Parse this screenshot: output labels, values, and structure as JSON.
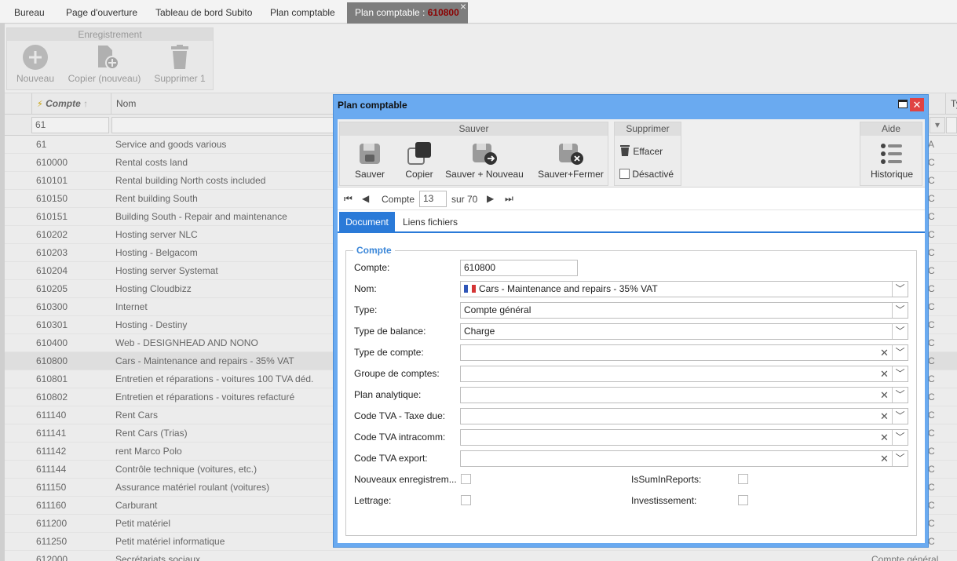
{
  "tabs": [
    {
      "label": "Bureau"
    },
    {
      "label": "Page d'ouverture"
    },
    {
      "label": "Tableau de bord Subito"
    },
    {
      "label": "Plan comptable"
    },
    {
      "label": "Plan comptable : ",
      "code": "610800",
      "close": "×"
    }
  ],
  "ribbon": {
    "group_title": "Enregistrement",
    "nouveau": "Nouveau",
    "copier": "Copier (nouveau)",
    "supprimer": "Supprimer 1"
  },
  "grid": {
    "col_compte": "Compte",
    "col_nom": "Nom",
    "col_type_partial": "Ty",
    "filter_compte": "61",
    "rows": [
      {
        "compte": "61",
        "nom": "Service and goods various",
        "right": "A"
      },
      {
        "compte": "610000",
        "nom": "Rental costs land",
        "right": "C"
      },
      {
        "compte": "610101",
        "nom": "Rental building North costs included",
        "right": "C"
      },
      {
        "compte": "610150",
        "nom": "Rent building South",
        "right": "C"
      },
      {
        "compte": "610151",
        "nom": "Building South - Repair and maintenance",
        "right": "C"
      },
      {
        "compte": "610202",
        "nom": "Hosting server NLC",
        "right": "C"
      },
      {
        "compte": "610203",
        "nom": "Hosting - Belgacom",
        "right": "C"
      },
      {
        "compte": "610204",
        "nom": "Hosting server Systemat",
        "right": "C"
      },
      {
        "compte": "610205",
        "nom": "Hosting Cloudbizz",
        "right": "C"
      },
      {
        "compte": "610300",
        "nom": "Internet",
        "right": "C"
      },
      {
        "compte": "610301",
        "nom": "Hosting - Destiny",
        "right": "C"
      },
      {
        "compte": "610400",
        "nom": "Web - DESIGNHEAD AND NONO",
        "right": "C"
      },
      {
        "compte": "610800",
        "nom": "Cars - Maintenance and repairs - 35% VAT",
        "right": "C"
      },
      {
        "compte": "610801",
        "nom": "Entretien et réparations - voitures 100 TVA déd.",
        "right": "C"
      },
      {
        "compte": "610802",
        "nom": "Entretien et réparations - voitures refacturé",
        "right": "C"
      },
      {
        "compte": "611140",
        "nom": "Rent Cars",
        "right": "C"
      },
      {
        "compte": "611141",
        "nom": "Rent Cars (Trias)",
        "right": "C"
      },
      {
        "compte": "611142",
        "nom": "rent Marco Polo",
        "right": "C"
      },
      {
        "compte": "611144",
        "nom": "Contrôle technique (voitures, etc.)",
        "right": "C"
      },
      {
        "compte": "611150",
        "nom": "Assurance matériel roulant (voitures)",
        "right": "C"
      },
      {
        "compte": "611160",
        "nom": "Carburant",
        "right": "C"
      },
      {
        "compte": "611200",
        "nom": "Petit matériel",
        "right": "C"
      },
      {
        "compte": "611250",
        "nom": "Petit matériel informatique",
        "right": "C"
      },
      {
        "compte": "612000",
        "nom": "Secrétariats sociaux",
        "right": "Compte général"
      }
    ]
  },
  "dialog": {
    "title": "Plan comptable",
    "sauver_group": "Sauver",
    "sauver": "Sauver",
    "copier": "Copier",
    "sauver_nouveau": "Sauver + Nouveau",
    "sauver_fermer": "Sauver+Fermer",
    "supprimer_group": "Supprimer",
    "effacer": "Effacer",
    "desactive": "Désactivé",
    "aide_group": "Aide",
    "historique": "Historique",
    "nav_label": "Compte",
    "nav_value": "13",
    "nav_total": "sur 70",
    "tab_document": "Document",
    "tab_liens": "Liens fichiers",
    "section": "Compte",
    "fields": {
      "compte_label": "Compte:",
      "compte_value": "610800",
      "nom_label": "Nom:",
      "nom_value": "Cars - Maintenance and repairs - 35% VAT",
      "type_label": "Type:",
      "type_value": "Compte général",
      "balance_label": "Type de balance:",
      "balance_value": "Charge",
      "typecompte_label": "Type de compte:",
      "groupe_label": "Groupe de comptes:",
      "analytique_label": "Plan analytique:",
      "tva_due_label": "Code TVA - Taxe due:",
      "tva_intra_label": "Code TVA intracomm:",
      "tva_export_label": "Code TVA export:",
      "nouveaux_label": "Nouveaux enregistrem...",
      "issum_label": "IsSumInReports:",
      "lettrage_label": "Lettrage:",
      "invest_label": "Investissement:"
    }
  }
}
